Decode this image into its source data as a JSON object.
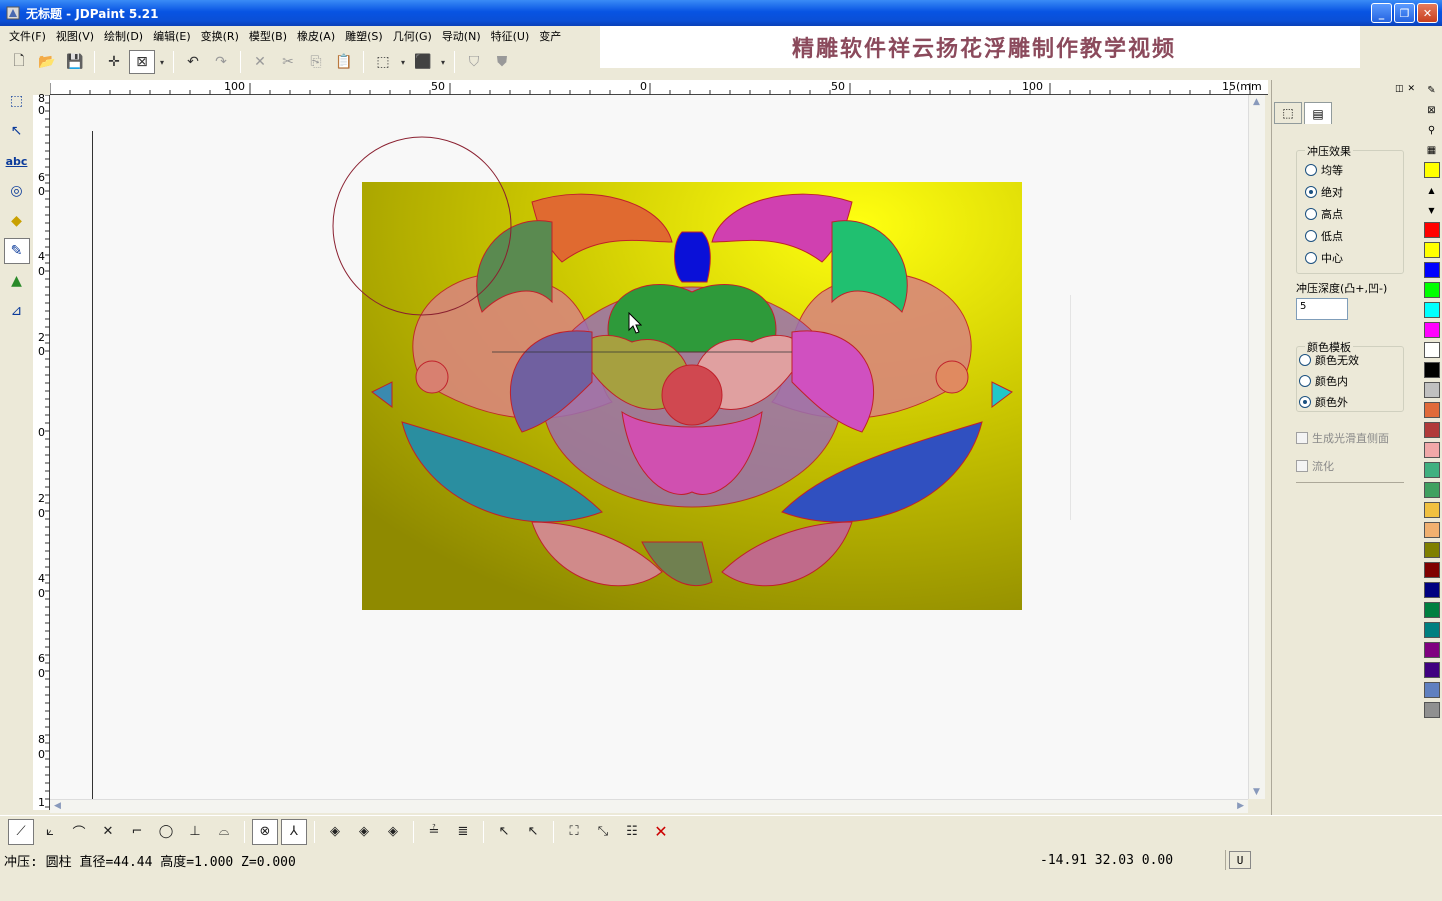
{
  "window": {
    "title": "无标题 - JDPaint 5.21"
  },
  "menu": [
    "文件(F)",
    "视图(V)",
    "绘制(D)",
    "编辑(E)",
    "变换(R)",
    "模型(B)",
    "橡皮(A)",
    "雕塑(S)",
    "几何(G)",
    "导动(N)",
    "特征(U)",
    "变产"
  ],
  "banner": "精雕软件祥云扬花浮雕制作教学视频",
  "ruler": {
    "top_labels": [
      "100",
      "50",
      "0",
      "50",
      "100",
      "15(mm"
    ],
    "left_labels": [
      "8",
      "0",
      "6",
      "0",
      "4",
      "0",
      "2",
      "0",
      "0",
      "2",
      "0",
      "4",
      "0",
      "6",
      "0",
      "8",
      "0",
      "1"
    ]
  },
  "right_panel": {
    "press_effect": {
      "title": "冲压效果",
      "options": [
        "均等",
        "绝对",
        "高点",
        "低点",
        "中心"
      ],
      "selected": "绝对"
    },
    "depth": {
      "label": "冲压深度(凸+,凹-)",
      "value": "5"
    },
    "color_template": {
      "title": "颜色模板",
      "options": [
        "颜色无效",
        "颜色内",
        "颜色外"
      ],
      "selected": "颜色外"
    },
    "checkboxes": [
      {
        "label": "生成光滑直侧面",
        "checked": false
      },
      {
        "label": "流化",
        "checked": false
      }
    ]
  },
  "palette": [
    "#ffff00",
    "#ff0000",
    "#ffff00",
    "#0000ff",
    "#00ff00",
    "#00ffff",
    "#ff00ff",
    "#ffffff",
    "#000000",
    "#c0c0c0",
    "#e06a3a",
    "#b03a3a",
    "#f0a8a8",
    "#40b080",
    "#40a060",
    "#f0c040",
    "#f0b070",
    "#808000",
    "#800000",
    "#000080",
    "#008040",
    "#008080",
    "#800080",
    "#400080",
    "#6080c0",
    "#909090"
  ],
  "status": {
    "left": "冲压: 圆柱  直径=44.44  高度=1.000  Z=0.000",
    "coords": "-14.91 32.03 0.00",
    "mode": "U"
  }
}
